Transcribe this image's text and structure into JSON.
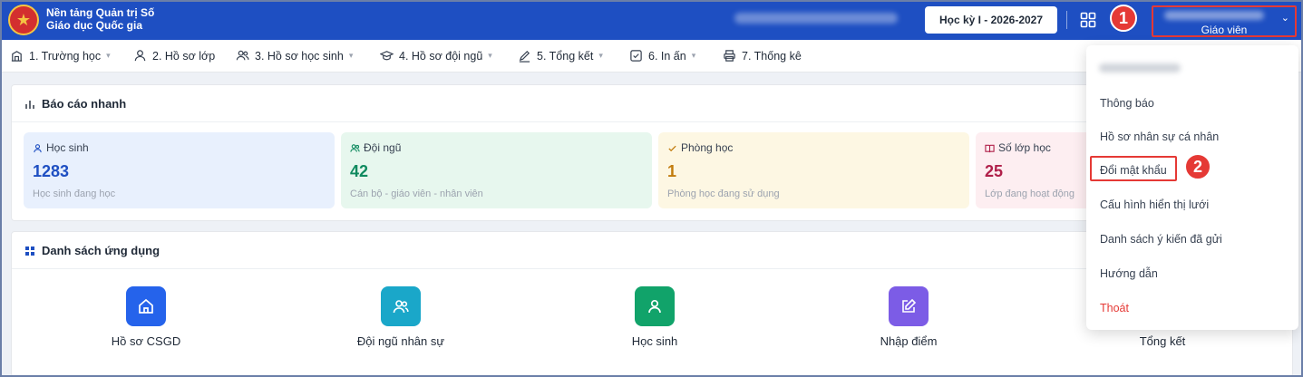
{
  "header": {
    "brand_line1": "Nền tảng Quản trị Số",
    "brand_line2": "Giáo dục Quốc gia",
    "term": "Học kỳ I - 2026-2027",
    "user_role": "Giáo viên",
    "step1": "1",
    "step2": "2"
  },
  "nav": {
    "items": [
      {
        "label": "1. Trường học",
        "icon": "building-icon"
      },
      {
        "label": "2. Hồ sơ lớp",
        "icon": "user-icon"
      },
      {
        "label": "3. Hồ sơ học sinh",
        "icon": "users-icon"
      },
      {
        "label": "4. Hồ sơ đội ngũ",
        "icon": "graduation-cap-icon"
      },
      {
        "label": "5. Tổng kết",
        "icon": "pencil-icon"
      },
      {
        "label": "6. In ấn",
        "icon": "checkbox-icon"
      },
      {
        "label": "7. Thống kê",
        "icon": "printer-icon"
      }
    ]
  },
  "quick_report": {
    "title": "Báo cáo nhanh",
    "stats": [
      {
        "label": "Học sinh",
        "value": "1283",
        "sub": "Học sinh đang học",
        "color": "#1e4fc2",
        "bg": "#e8f0fd"
      },
      {
        "label": "Đội ngũ",
        "value": "42",
        "sub": "Cán bộ - giáo viên - nhân viên",
        "color": "#0f8a5f",
        "bg": "#e7f7ee"
      },
      {
        "label": "Phòng học",
        "value": "1",
        "sub": "Phòng học đang sử dụng",
        "color": "#c27c0e",
        "bg": "#fdf7e3"
      },
      {
        "label": "Số lớp học",
        "value": "25",
        "sub": "Lớp đang hoạt động",
        "color": "#b0204a",
        "bg": "#fdeef1"
      }
    ]
  },
  "apps": {
    "title": "Danh sách ứng dụng",
    "items": [
      {
        "label": "Hồ sơ CSGD",
        "color": "#2563eb"
      },
      {
        "label": "Đội ngũ nhân sự",
        "color": "#1aa7c9"
      },
      {
        "label": "Học sinh",
        "color": "#11a36a"
      },
      {
        "label": "Nhập điểm",
        "color": "#7c5ce6"
      },
      {
        "label": "Tổng kết",
        "color": "#f59e0b"
      }
    ]
  },
  "dropdown": {
    "items": [
      "Thông báo",
      "Hồ sơ nhân sự cá nhân",
      "Đổi mật khẩu",
      "Cấu hình hiển thị lưới",
      "Danh sách ý kiến đã gửi",
      "Hướng dẫn",
      "Thoát"
    ]
  }
}
